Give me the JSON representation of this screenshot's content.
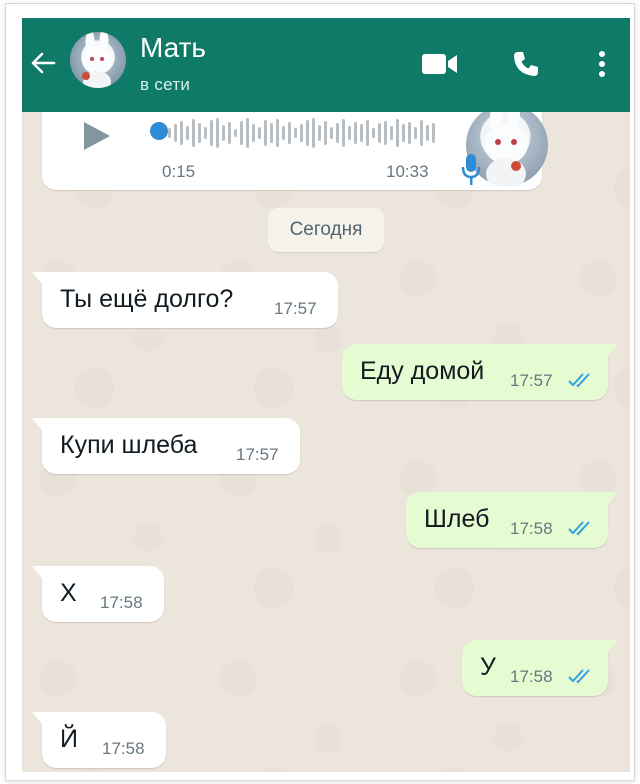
{
  "header": {
    "contact_name": "Мать",
    "status": "в сети",
    "back_icon": "arrow-left-icon",
    "video_icon": "video-camera-icon",
    "call_icon": "phone-icon",
    "menu_icon": "more-vertical-icon"
  },
  "voice_message": {
    "duration": "0:15",
    "time": "10:33",
    "progress": 0.0
  },
  "date_separator": "Сегодня",
  "messages": [
    {
      "direction": "in",
      "text": "Ты ещё долго?",
      "time": "17:57"
    },
    {
      "direction": "out",
      "text": "Еду домой",
      "time": "17:57",
      "read": true
    },
    {
      "direction": "in",
      "text": "Купи шлеба",
      "time": "17:57"
    },
    {
      "direction": "out",
      "text": "Шлеб",
      "time": "17:58",
      "read": true
    },
    {
      "direction": "in",
      "text": "Х",
      "time": "17:58"
    },
    {
      "direction": "out",
      "text": "У",
      "time": "17:58",
      "read": true
    },
    {
      "direction": "in",
      "text": "Й",
      "time": "17:58"
    }
  ],
  "colors": {
    "header": "#0f7a68",
    "incoming_bubble": "#ffffff",
    "outgoing_bubble": "#e6fbd2",
    "read_ticks": "#34a0e0",
    "chat_background": "#ece5dc"
  }
}
